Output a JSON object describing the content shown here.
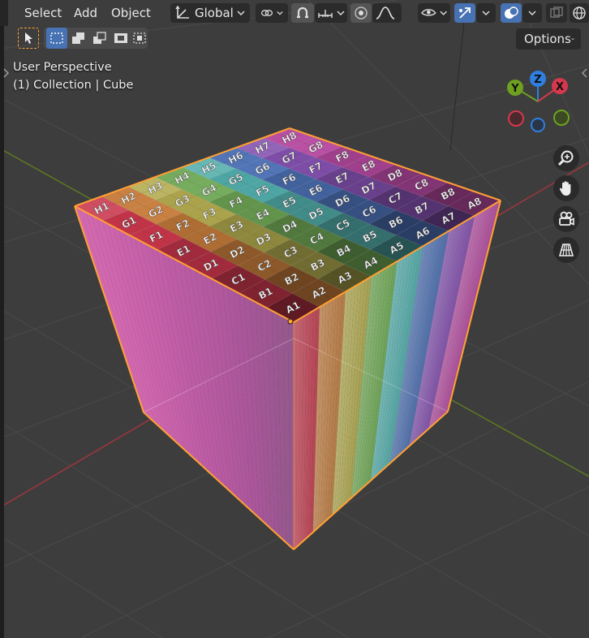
{
  "header": {
    "menus": [
      "Select",
      "Add",
      "Object"
    ],
    "orientation_label": "Global",
    "options_label": "Options",
    "icons": [
      "transform-orientation-icon",
      "pivot-link-icon",
      "snap-magnet-icon",
      "snap-increment-icon",
      "proportional-edit-icon",
      "falloff-curve-icon",
      "visibility-eye-icon",
      "gizmo-icon",
      "overlay-icon",
      "xray-icon",
      "shading-wire-icon"
    ]
  },
  "overlay": {
    "view_name": "User Perspective",
    "collection_text": "(1) Collection | Cube"
  },
  "gizmo": {
    "axes": [
      {
        "label": "Z",
        "color": "#2f7fe0"
      },
      {
        "label": "Y",
        "color": "#6ea11f"
      },
      {
        "label": "X",
        "color": "#d5384c"
      }
    ]
  },
  "nav": [
    "zoom-icon",
    "pan-hand-icon",
    "camera-icon",
    "perspective-grid-icon"
  ],
  "colors": {
    "accent": "#4772b3",
    "selection_outline": "#ffa034",
    "viewport_bg": "#3d3d3d"
  },
  "cube": {
    "rows": [
      "A",
      "B",
      "C",
      "D",
      "E",
      "F",
      "G",
      "H"
    ],
    "cols": [
      "1",
      "2",
      "3",
      "4",
      "5",
      "6",
      "7",
      "8"
    ],
    "hue_stripes": [
      "#e03d54",
      "#d97d2a",
      "#c2b83a",
      "#5faa3d",
      "#36a6a3",
      "#3b6cc8",
      "#8a45c5",
      "#cc3fb0"
    ]
  }
}
